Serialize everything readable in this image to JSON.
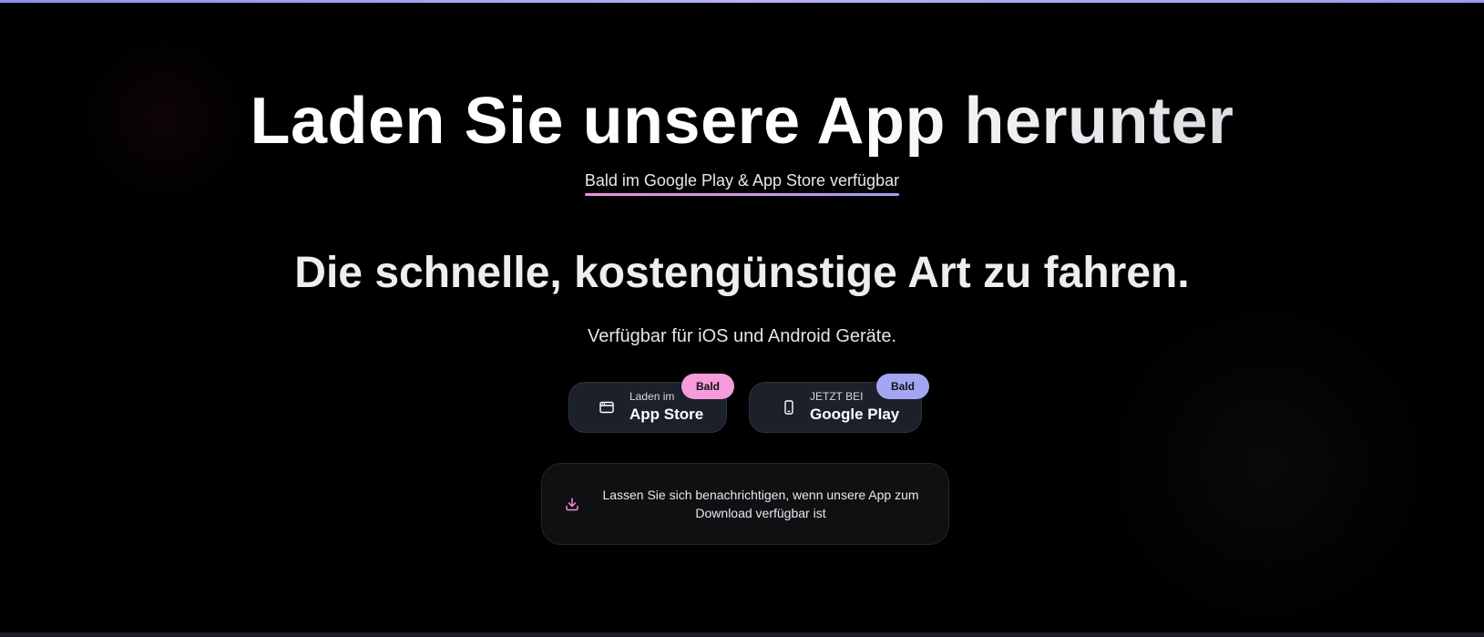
{
  "hero": {
    "title": "Laden Sie unsere App herunter",
    "subtitle": "Bald im Google Play & App Store verfügbar"
  },
  "main": {
    "tagline": "Die schnelle, kostengünstige Art zu fahren.",
    "availability": "Verfügbar für iOS und Android Geräte."
  },
  "stores": {
    "appstore": {
      "small_label": "Laden im",
      "big_label": "App Store",
      "badge": "Bald",
      "icon": "browser-window-icon",
      "badge_color": "#f59bdc"
    },
    "googleplay": {
      "small_label": "JETZT BEI",
      "big_label": "Google Play",
      "badge": "Bald",
      "icon": "smartphone-icon",
      "badge_color": "#a3a7f2"
    }
  },
  "notify": {
    "text": "Lassen Sie sich benachrichtigen, wenn unsere App zum Download verfügbar ist",
    "icon": "download-icon",
    "icon_color": "#f48fd8"
  },
  "colors": {
    "background": "#000000",
    "accent_pink": "#f48fd8",
    "accent_violet": "#a89cf5",
    "button_bg": "#1b202a"
  }
}
